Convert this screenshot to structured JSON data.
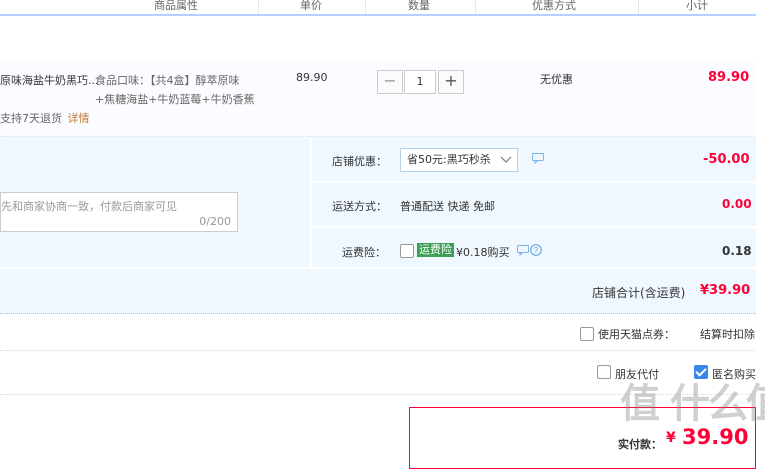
{
  "header": {
    "col_attr": "商品属性",
    "col_price": "单价",
    "col_qty": "数量",
    "col_promo": "优惠方式",
    "col_subtotal": "小计"
  },
  "item": {
    "title": "原味海盐牛奶黑巧...",
    "return_policy": "支持7天退货",
    "detail_link": "详情",
    "attr_line1": "食品口味：【共4盒】醇萃原味",
    "attr_line2": "+焦糖海盐+牛奶蓝莓+牛奶香蕉",
    "price": "89.90",
    "quantity": "1",
    "qty_minus": "−",
    "qty_plus": "+",
    "promo": "无优惠",
    "subtotal": "89.90"
  },
  "shop": {
    "discount_label": "店铺优惠：",
    "discount_value": "省50元:黑巧秒杀",
    "discount_amount": "-50.00",
    "message_placeholder": "先和商家协商一致，付款后商家可见",
    "message_count": "0/200",
    "shipping_label": "运送方式：",
    "shipping_value": "普通配送 快递 免邮",
    "shipping_amount": "0.00",
    "insurance_label": "运费险：",
    "insurance_tag": "运费险",
    "insurance_value": "¥0.18购买",
    "insurance_amount": "0.18",
    "total_label": "店铺合计(含运费)",
    "total_amount": "¥39.90"
  },
  "options": {
    "tmall_points_label": "使用天猫点券：",
    "tmall_points_note": "结算时扣除",
    "friend_pay_label": "朋友代付",
    "anonymous_label": "匿名购买",
    "anonymous_checked": true
  },
  "payment": {
    "label": "实付款：",
    "amount": "39.90",
    "currency": "¥"
  },
  "watermark": "值 什么值得买"
}
